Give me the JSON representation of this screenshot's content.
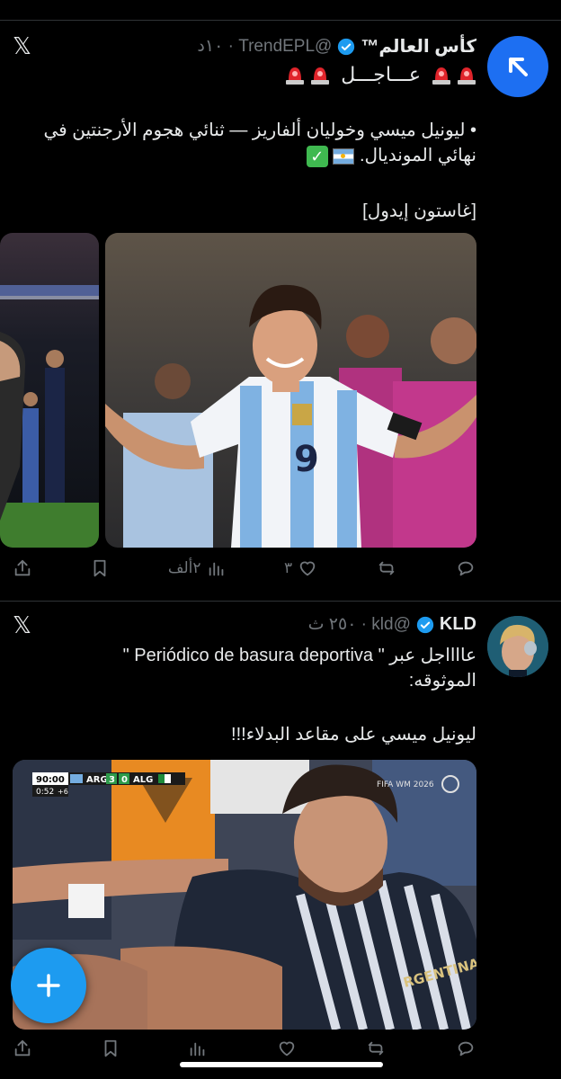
{
  "tweet1": {
    "author_name": "كأس العالم™",
    "handle_time": "@TrendEPL · ١٠د",
    "breaking": "عـــاجـــل",
    "body_line1": "• ليونيل ميسي وخوليان ألفاريز — ثنائي هجوم الأرجنتين في",
    "body_line2": "نهائي المونديال.",
    "credit": "[غاستون إيدول]",
    "jersey_number": "9",
    "actions": {
      "views": "٢ألف",
      "likes": "٣"
    }
  },
  "tweet2": {
    "author_name": "KLD",
    "handle_time": "@kld · ٢٥٠ ث",
    "body_line1": "عااااجل عبر \" Periódico de basura deportiva \"",
    "body_line2": "الموثوقه:",
    "body_line3": "ليونيل ميسي على مقاعد البدلاء!!!",
    "scoreboard": {
      "clock": "90:00",
      "period_time": "0:52",
      "added": "+6",
      "team1": "ARG",
      "score1": "3",
      "score2": "0",
      "team2": "ALG"
    },
    "watermark": "FIFA WM 2026",
    "shirt_text": "RGENTINA"
  },
  "colors": {
    "accent": "#1d9bf0",
    "verified": "#1d9bf0",
    "muted": "#71767b",
    "divider": "#2f3336"
  }
}
